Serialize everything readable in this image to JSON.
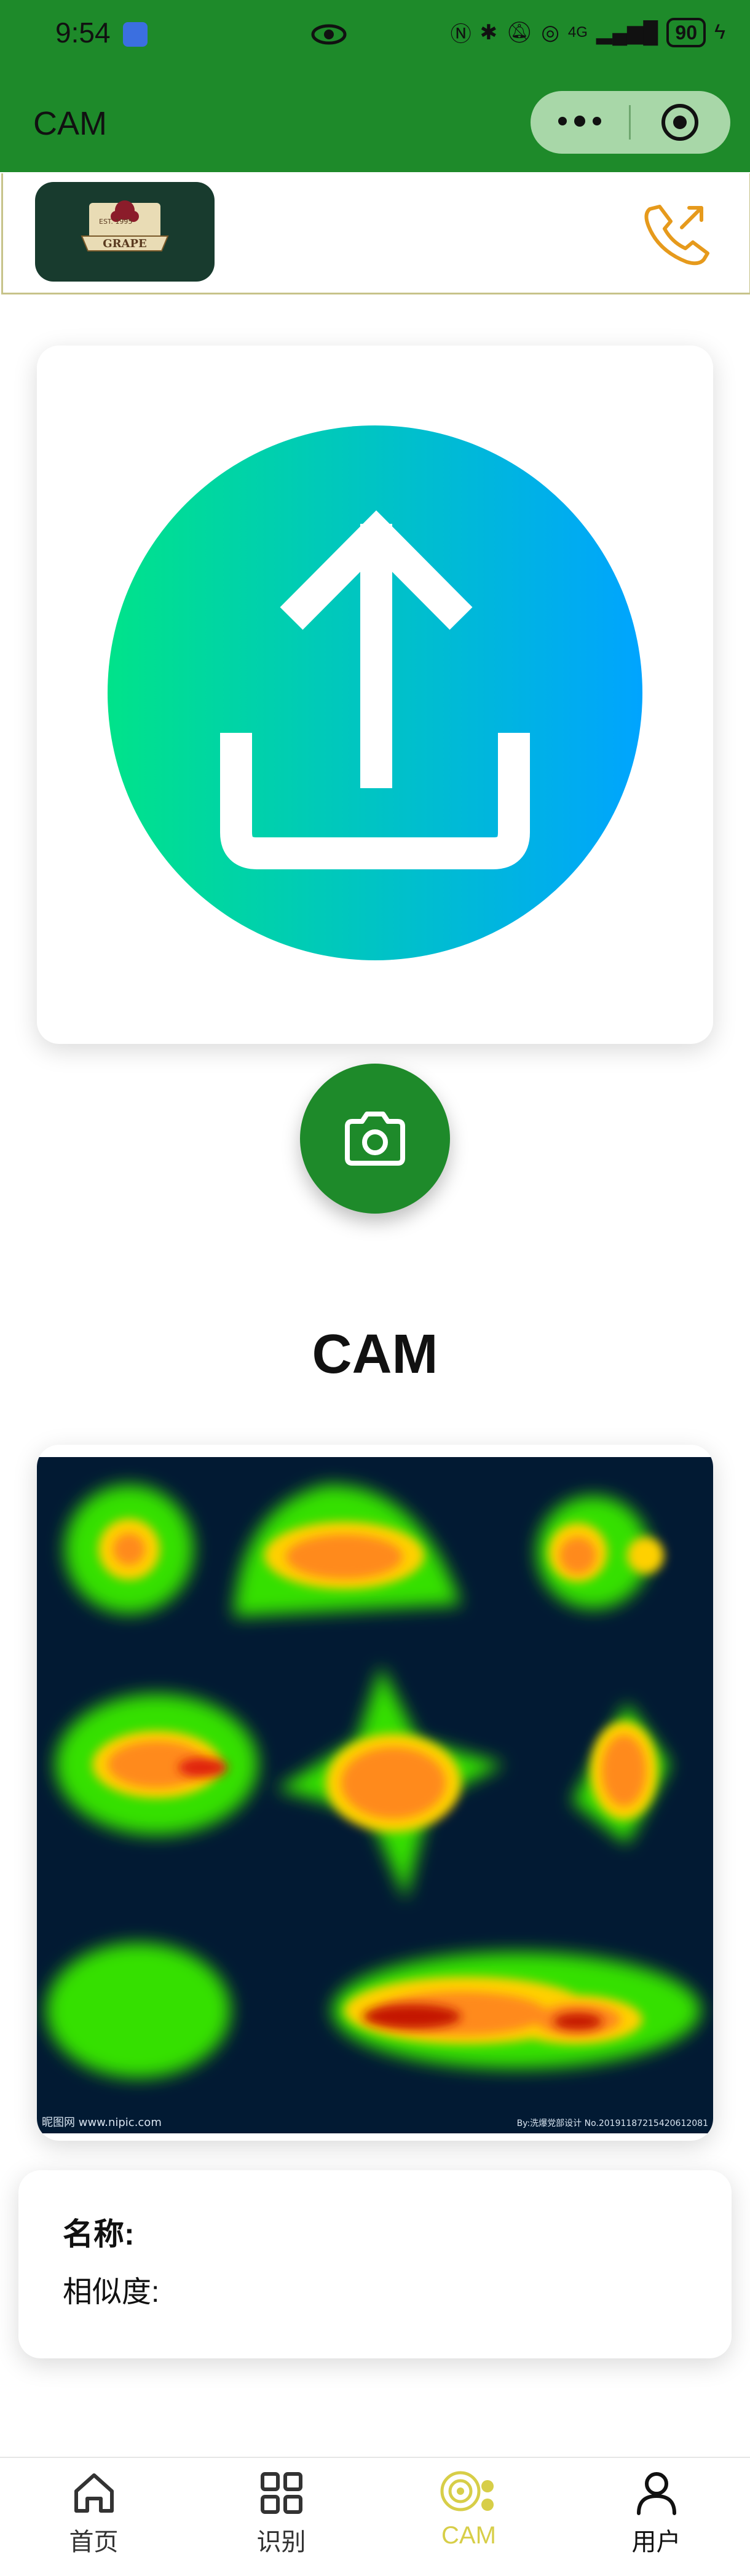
{
  "status_bar": {
    "time": "9:54",
    "network": "4G",
    "battery": "90"
  },
  "nav": {
    "title": "CAM"
  },
  "brand": {
    "logo_text_top": "EST. 1995",
    "logo_text": "GRAPE"
  },
  "heading": "CAM",
  "heatmap": {
    "watermark_left": "昵图网 www.nipic.com",
    "watermark_right": "By:洗爆党部设计 No.20191187215420612081"
  },
  "result": {
    "name_label": "名称:",
    "similarity_label": "相似度:"
  },
  "tabbar": {
    "items": [
      {
        "label": "首页",
        "icon": "home-icon"
      },
      {
        "label": "识别",
        "icon": "grid-icon"
      },
      {
        "label": "CAM",
        "icon": "cam-icon"
      },
      {
        "label": "用户",
        "icon": "user-icon"
      }
    ],
    "active_color": "#d7ce48"
  },
  "colors": {
    "brand_green": "#1e8a2a",
    "upload_gradient_start": "#00e38a",
    "upload_gradient_end": "#00a4ff",
    "heatmap_background": "#021a33"
  }
}
